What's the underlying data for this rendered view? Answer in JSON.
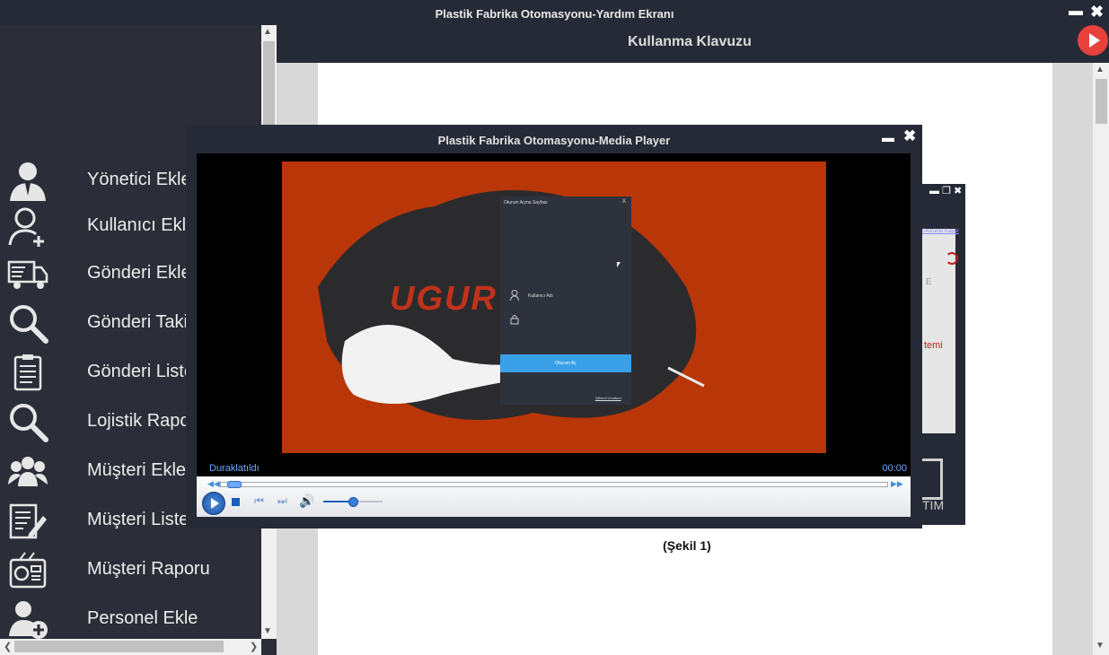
{
  "window": {
    "title": "Plastik Fabrika Otomasyonu-Yardım Ekranı"
  },
  "header": {
    "title": "Kullanma Klavuzu"
  },
  "sidebar": {
    "items": [
      {
        "label": "Yönetici Ekle",
        "icon": "manager-icon"
      },
      {
        "label": "Kullanıcı Ekle",
        "icon": "add-user-icon"
      },
      {
        "label": "Gönderi Ekle",
        "icon": "truck-icon"
      },
      {
        "label": "Gönderi Takip",
        "icon": "search-icon"
      },
      {
        "label": "Gönderi Listesi",
        "icon": "clipboard-icon"
      },
      {
        "label": "Lojistik Raporu",
        "icon": "search-icon"
      },
      {
        "label": "Müşteri Ekle",
        "icon": "group-icon"
      },
      {
        "label": "Müşteri Listesi",
        "icon": "list-edit-icon"
      },
      {
        "label": "Müşteri Raporu",
        "icon": "report-icon"
      },
      {
        "label": "Personel Ekle",
        "icon": "add-person-icon"
      }
    ]
  },
  "document": {
    "caption": "(Şekil 1)"
  },
  "media_player": {
    "title": "Plastik Fabrika Otomasyonu-Media Player",
    "status": "Duraklatıldı",
    "time": "00:00",
    "volume": 0.5,
    "progress": 0.01
  },
  "video_frame": {
    "logo_text": "UGUR",
    "login": {
      "title": "Oturum Açma Sayfası",
      "close": "X",
      "username_label": "Kullanıcı Adı",
      "button": "Oturum Aç",
      "forgot": "Şifremi Unuttum"
    }
  },
  "background_window": {
    "link": "Oturumu Kapat",
    "text_a": "E",
    "text_b": "temi",
    "text_c": "TİM"
  },
  "colors": {
    "accent": "#e8413b",
    "dark": "#262a36",
    "login_button": "#3aa0e8",
    "video_bg": "#b93608"
  }
}
